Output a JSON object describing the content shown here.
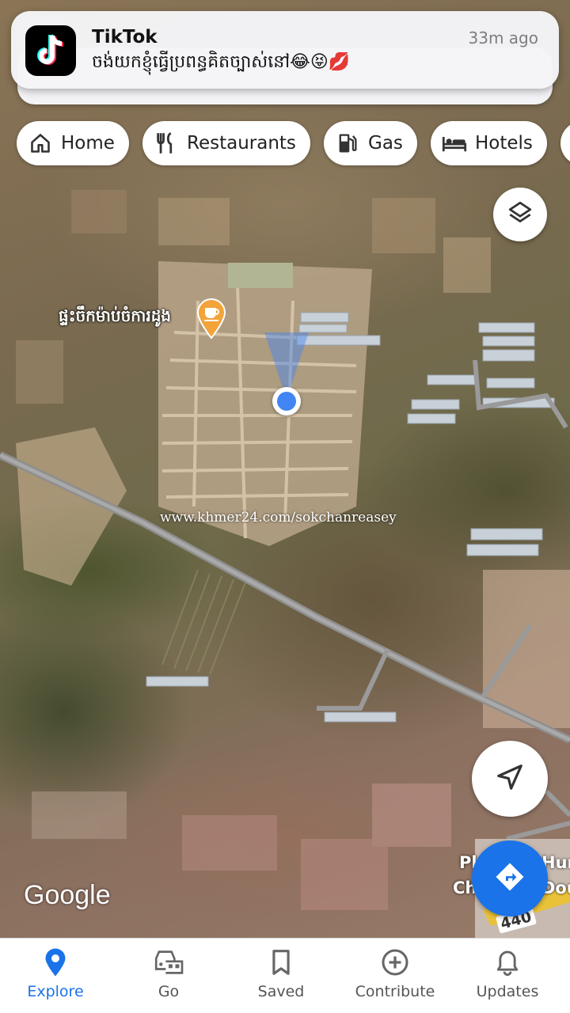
{
  "notification": {
    "app_name": "TikTok",
    "time": "33m ago",
    "message": "ចង់យកខ្ញុំធ្វើប្រពន្ធគិតច្បាស់នៅ😂😝💋"
  },
  "chips": [
    {
      "label": "Home",
      "icon": "home-icon"
    },
    {
      "label": "Restaurants",
      "icon": "fork-knife-icon"
    },
    {
      "label": "Gas",
      "icon": "gas-pump-icon"
    },
    {
      "label": "Hotels",
      "icon": "bed-icon"
    }
  ],
  "map": {
    "place_label": "ផ្ទះចឹកម៉ាប់ចំការដូង",
    "place_icon": "coffee-cup-icon",
    "watermark": "www.khmer24.com/sokchanreasey",
    "attribution": "Google",
    "partial_label_1": "Pl",
    "partial_label_2": "Hur",
    "partial_label_3": "Ch",
    "partial_label_4": "Dou",
    "road_number": "440"
  },
  "controls": {
    "layers_icon": "layers-icon",
    "location_icon": "navigation-arrow-icon",
    "directions_icon": "directions-icon"
  },
  "bottom_nav": [
    {
      "label": "Explore",
      "icon": "location-pin-icon",
      "active": true
    },
    {
      "label": "Go",
      "icon": "car-icon",
      "active": false
    },
    {
      "label": "Saved",
      "icon": "bookmark-icon",
      "active": false
    },
    {
      "label": "Contribute",
      "icon": "add-circle-icon",
      "active": false
    },
    {
      "label": "Updates",
      "icon": "bell-icon",
      "active": false
    }
  ],
  "colors": {
    "accent": "#1a73e8",
    "location_dot": "#4285f4",
    "place_pin": "#f2a33a"
  }
}
